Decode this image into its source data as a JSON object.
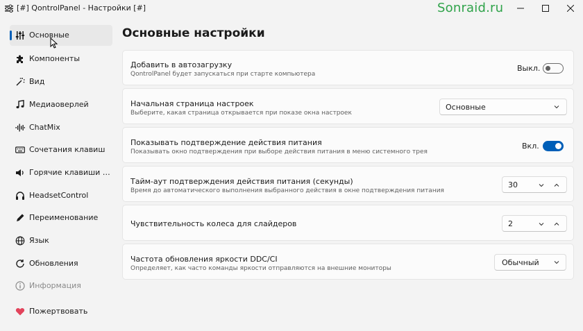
{
  "window": {
    "title": "[#] QontrolPanel - Настройки [#]",
    "watermark": "Sonraid.ru"
  },
  "sidebar": {
    "items": [
      {
        "label": "Основные",
        "icon": "sliders-icon",
        "active": true
      },
      {
        "label": "Компоненты",
        "icon": "puzzle-icon"
      },
      {
        "label": "Вид",
        "icon": "magic-wand-icon"
      },
      {
        "label": "Медиаоверлей",
        "icon": "music-note-icon"
      },
      {
        "label": "ChatMix",
        "icon": "waveform-icon"
      },
      {
        "label": "Сочетания клавиш",
        "icon": "keyboard-icon"
      },
      {
        "label": "Горячие клавиши пр...",
        "icon": "speaker-icon"
      },
      {
        "label": "HeadsetControl",
        "icon": "headphones-icon"
      },
      {
        "label": "Переименование",
        "icon": "pencil-icon"
      },
      {
        "label": "Язык",
        "icon": "globe-icon"
      },
      {
        "label": "Обновления",
        "icon": "refresh-icon"
      },
      {
        "label": "Информация",
        "icon": "info-icon",
        "disabled": true
      },
      {
        "label": "Пожертвовать",
        "icon": "heart-icon"
      }
    ]
  },
  "main": {
    "title": "Основные настройки",
    "settings": {
      "autostart": {
        "title": "Добавить в автозагрузку",
        "subtitle": "QontrolPanel будет запускаться при старте компьютера",
        "state_label": "Выкл.",
        "on": false
      },
      "start_page": {
        "title": "Начальная страница настроек",
        "subtitle": "Выберите, какая страница открывается при показе окна настроек",
        "value": "Основные"
      },
      "power_confirm": {
        "title": "Показывать подтверждение действия питания",
        "subtitle": "Показывать окно подтверждения при выборе действия питания в меню системного трея",
        "state_label": "Вкл.",
        "on": true
      },
      "power_timeout": {
        "title": "Тайм-аут подтверждения действия питания (секунды)",
        "subtitle": "Время до автоматического выполнения выбранного действия в окне подтверждения питания",
        "value": "30"
      },
      "wheel_sensitivity": {
        "title": "Чувствительность колеса для слайдеров",
        "value": "2"
      },
      "ddc_rate": {
        "title": "Частота обновления яркости DDC/CI",
        "subtitle": "Определяет, как часто команды яркости отправляются на внешние мониторы",
        "value": "Обычный"
      }
    }
  },
  "colors": {
    "accent": "#005fb8",
    "watermark": "#2fa34a",
    "heart": "#e2435b"
  }
}
